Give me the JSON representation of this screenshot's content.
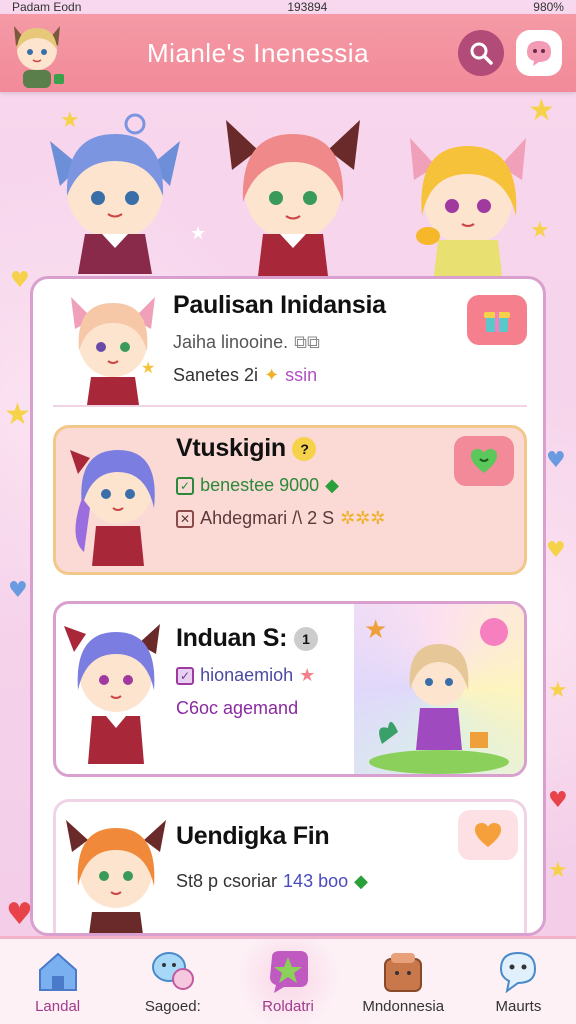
{
  "status_bar": {
    "carrier": "Padam Eodn",
    "time": "193894",
    "battery": "980%"
  },
  "header": {
    "title": "Mianle's Inenessia"
  },
  "cards": [
    {
      "name": "Paulisan Inidansia",
      "line1": "Jaiha linooine.",
      "line2": "Sanetes 2i",
      "line2_extra": "ssin"
    },
    {
      "name": "Vtuskigin",
      "line1": "benestee 9000",
      "line2": "Ahdegmari /\\ 2 S"
    },
    {
      "name": "Induan S:",
      "line1": "hionaemioh",
      "line2": "C6oc agemand"
    },
    {
      "name": "Uendigka Fin",
      "line1": "St8 p csoriar",
      "line1_num": "143 boo"
    }
  ],
  "nav": [
    {
      "label": "Landal",
      "icon": "home-icon"
    },
    {
      "label": "Sagoed:",
      "icon": "chat-bubbles-icon"
    },
    {
      "label": "Roldatri",
      "icon": "star-badge-icon"
    },
    {
      "label": "Mndonnesia",
      "icon": "bag-icon"
    },
    {
      "label": "Maurts",
      "icon": "ghost-chat-icon"
    }
  ],
  "colors": {
    "header": "#f28a99",
    "accent": "#b34b79",
    "panel_border": "#d9a0cf",
    "card2_bg": "#fbd9d4",
    "card3_border": "#d9a0cf"
  }
}
